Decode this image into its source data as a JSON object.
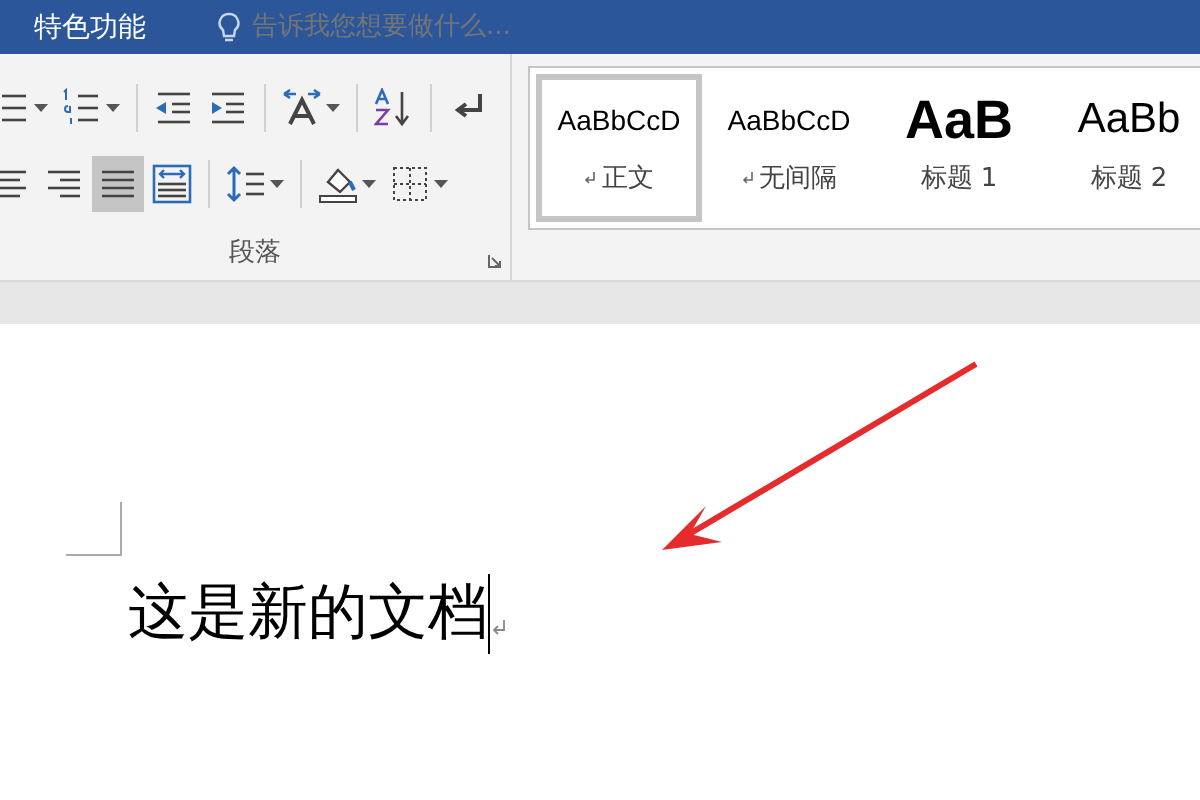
{
  "title_bar": {
    "tab": "特色功能",
    "tell_me": {
      "placeholder": "告诉我您想要做什么..."
    }
  },
  "paragraph_group": {
    "label": "段落",
    "rows": [
      [
        {
          "kind": "multilevel-list",
          "dropdown": true,
          "selected": false
        },
        {
          "kind": "numbered-list",
          "dropdown": true,
          "selected": false
        },
        {
          "kind": "sep"
        },
        {
          "kind": "decrease-indent",
          "dropdown": false,
          "selected": false
        },
        {
          "kind": "increase-indent",
          "dropdown": false,
          "selected": false
        },
        {
          "kind": "sep"
        },
        {
          "kind": "text-direction",
          "dropdown": true,
          "selected": false
        },
        {
          "kind": "sep"
        },
        {
          "kind": "sort",
          "dropdown": false,
          "selected": false
        },
        {
          "kind": "sep"
        },
        {
          "kind": "show-marks",
          "dropdown": false,
          "selected": false
        }
      ],
      [
        {
          "kind": "align-center",
          "dropdown": false,
          "selected": false
        },
        {
          "kind": "align-right",
          "dropdown": false,
          "selected": false
        },
        {
          "kind": "justify",
          "dropdown": false,
          "selected": true
        },
        {
          "kind": "distribute",
          "dropdown": false,
          "selected": false
        },
        {
          "kind": "sep"
        },
        {
          "kind": "line-spacing",
          "dropdown": true,
          "selected": false
        },
        {
          "kind": "sep"
        },
        {
          "kind": "shading",
          "dropdown": true,
          "selected": false
        },
        {
          "kind": "borders",
          "dropdown": true,
          "selected": false
        }
      ]
    ]
  },
  "styles": [
    {
      "kind": "normal",
      "preview": "AaBbCcD",
      "name": "正文",
      "paragraph_mark": true,
      "selected": true
    },
    {
      "kind": "no-spacing",
      "preview": "AaBbCcD",
      "name": "无间隔",
      "paragraph_mark": true,
      "selected": false
    },
    {
      "kind": "heading1",
      "preview": "AaB",
      "name": "标题 1",
      "paragraph_mark": false,
      "selected": false
    },
    {
      "kind": "heading2",
      "preview": "AaBb",
      "name": "标题 2",
      "paragraph_mark": false,
      "selected": false
    }
  ],
  "document": {
    "text": "这是新的文档",
    "cursor": true,
    "paragraph_mark": true
  }
}
